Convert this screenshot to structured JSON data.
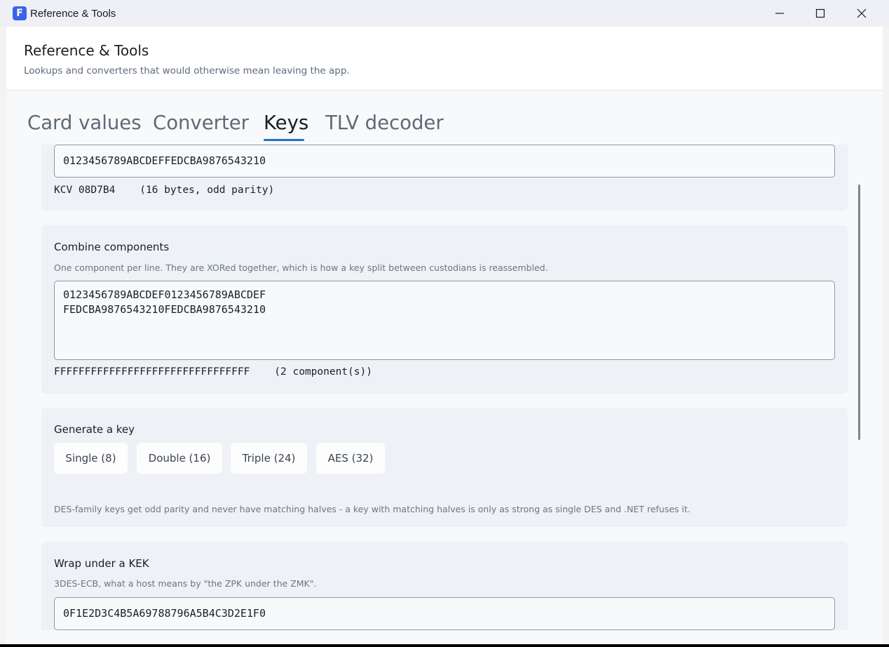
{
  "window": {
    "icon_letter": "F",
    "title": "Reference & Tools"
  },
  "header": {
    "title": "Reference & Tools",
    "subtitle": "Lookups and converters that would otherwise mean leaving the app."
  },
  "tabs": [
    {
      "label": "Card values"
    },
    {
      "label": "Converter"
    },
    {
      "label": "Keys"
    },
    {
      "label": "TLV decoder"
    }
  ],
  "active_tab": "Keys",
  "check_key": {
    "value": "0123456789ABCDEFFEDCBA9876543210",
    "result": "KCV 08D7B4    (16 bytes, odd parity)"
  },
  "combine": {
    "title": "Combine components",
    "description": "One component per line. They are XORed together, which is how a key split between custodians is reassembled.",
    "lines": [
      "0123456789ABCDEF0123456789ABCDEF",
      "FEDCBA9876543210FEDCBA9876543210"
    ],
    "result": "FFFFFFFFFFFFFFFFFFFFFFFFFFFFFFFF    (2 component(s))"
  },
  "generate": {
    "title": "Generate a key",
    "buttons": [
      {
        "label": "Single (8)"
      },
      {
        "label": "Double (16)"
      },
      {
        "label": "Triple (24)"
      },
      {
        "label": "AES (32)"
      }
    ],
    "note": "DES-family keys get odd parity and never have matching halves - a key with matching halves is only as strong as single DES and .NET refuses it."
  },
  "wrap": {
    "title": "Wrap under a KEK",
    "description": "3DES-ECB, what a host means by \"the ZPK under the ZMK\".",
    "value": "0F1E2D3C4B5A69788796A5B4C3D2E1F0"
  },
  "colors": {
    "accent": "#1e73c8",
    "app_icon": "#3b63e8"
  }
}
